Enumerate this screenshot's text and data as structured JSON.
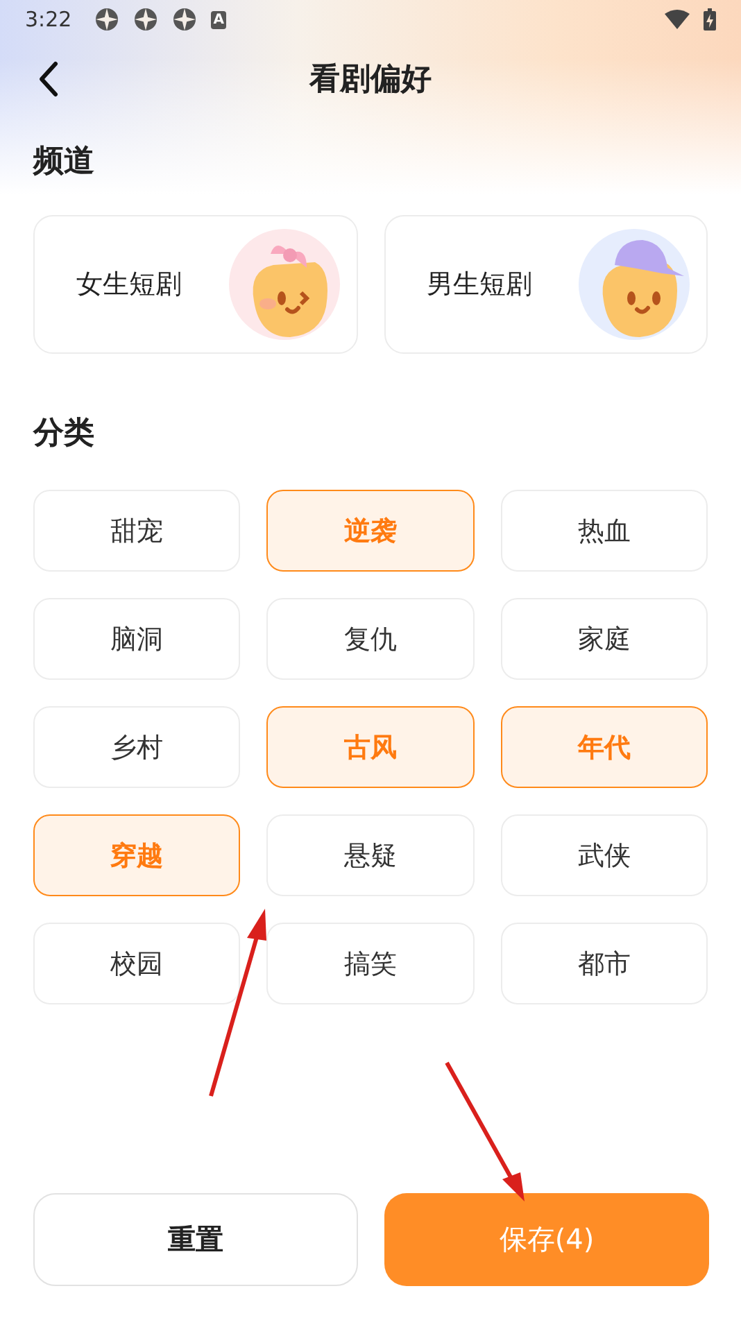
{
  "status_bar": {
    "time": "3:22",
    "badge": "A"
  },
  "header": {
    "title": "看剧偏好"
  },
  "channel_section": {
    "title": "频道",
    "channels": [
      {
        "label": "女生短剧",
        "kind": "girl"
      },
      {
        "label": "男生短剧",
        "kind": "boy"
      }
    ]
  },
  "category_section": {
    "title": "分类",
    "categories": [
      {
        "label": "甜宠",
        "selected": false
      },
      {
        "label": "逆袭",
        "selected": true
      },
      {
        "label": "热血",
        "selected": false
      },
      {
        "label": "脑洞",
        "selected": false
      },
      {
        "label": "复仇",
        "selected": false
      },
      {
        "label": "家庭",
        "selected": false
      },
      {
        "label": "乡村",
        "selected": false
      },
      {
        "label": "古风",
        "selected": true
      },
      {
        "label": "年代",
        "selected": true
      },
      {
        "label": "穿越",
        "selected": true
      },
      {
        "label": "悬疑",
        "selected": false
      },
      {
        "label": "武侠",
        "selected": false
      },
      {
        "label": "校园",
        "selected": false
      },
      {
        "label": "搞笑",
        "selected": false
      },
      {
        "label": "都市",
        "selected": false
      }
    ]
  },
  "buttons": {
    "reset": "重置",
    "save": "保存(4)"
  }
}
